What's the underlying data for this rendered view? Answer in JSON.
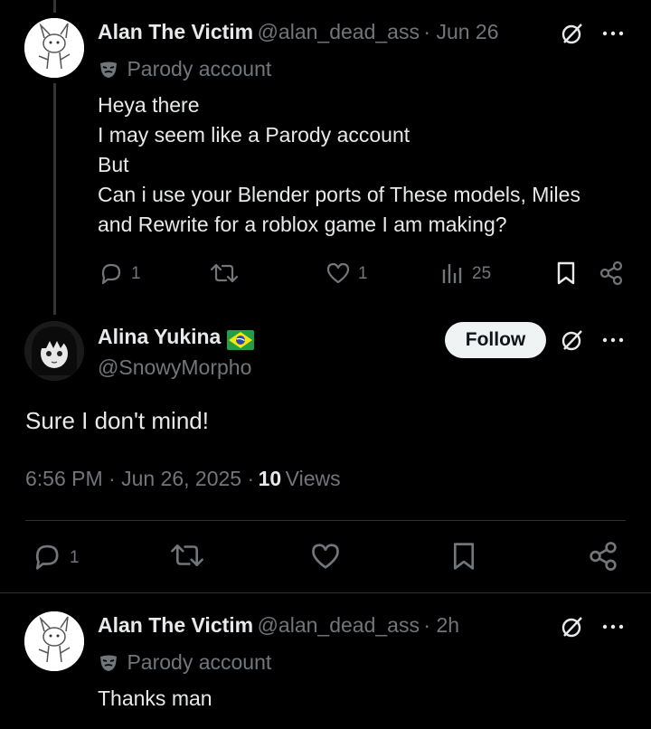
{
  "tweet1": {
    "name": "Alan The Victim",
    "handle": "@alan_dead_ass",
    "time": "· Jun 26",
    "parody_label": "Parody account",
    "text_lines": [
      "Heya there",
      "I may seem like a Parody account",
      "But",
      "Can i use your Blender ports of These models, Miles",
      "and Rewrite for a roblox game I am making?"
    ],
    "replies": "1",
    "likes": "1",
    "views": "25"
  },
  "main_tweet": {
    "name": "Alina Yukina",
    "handle": "@SnowyMorpho",
    "follow_label": "Follow",
    "text": "Sure I don't mind!",
    "timestamp": "6:56 PM · Jun 26, 2025 ·",
    "views_count": "10",
    "views_label": "Views",
    "replies": "1"
  },
  "tweet3": {
    "name": "Alan The Victim",
    "handle": "@alan_dead_ass",
    "time": "· 2h",
    "parody_label": "Parody account",
    "text": "Thanks man"
  },
  "colors": {
    "background": "#000000",
    "text": "#e7e9ea",
    "muted": "#71767b",
    "divider": "#2f3336"
  }
}
